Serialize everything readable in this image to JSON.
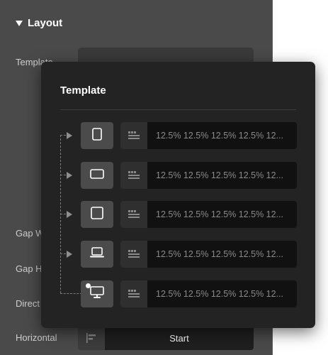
{
  "layout": {
    "title": "Layout",
    "rows": {
      "template": "Template",
      "gap_w": "Gap W",
      "gap_h": "Gap H",
      "direction": "Direct",
      "horizontal": "Horizontal"
    },
    "horizontal_value": "Start"
  },
  "popover": {
    "title": "Template",
    "breakpoints": [
      {
        "device": "mobile-icon",
        "value": "12.5% 12.5% 12.5% 12.5% 12..."
      },
      {
        "device": "tablet-landscape-icon",
        "value": "12.5% 12.5% 12.5% 12.5% 12..."
      },
      {
        "device": "tablet-icon",
        "value": "12.5% 12.5% 12.5% 12.5% 12..."
      },
      {
        "device": "laptop-icon",
        "value": "12.5% 12.5% 12.5% 12.5% 12..."
      },
      {
        "device": "desktop-icon",
        "value": "12.5% 12.5% 12.5% 12.5% 12..."
      }
    ]
  },
  "colors": {
    "panel_bg": "#4a4a4a",
    "popover_bg": "#232323",
    "field_bg": "#111111",
    "device_btn_bg": "#4b4b4b"
  }
}
